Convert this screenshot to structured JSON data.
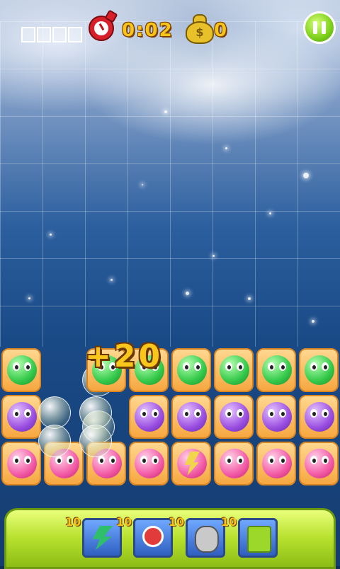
{
  "hud": {
    "timer": "0:02",
    "coins": "0",
    "progress_slots": 4,
    "clock_icon": "alarm-clock-icon",
    "bag_icon": "money-bag-icon",
    "bag_symbol": "$",
    "pause_icon": "pause-icon"
  },
  "board": {
    "score_popup": "+20",
    "rows": [
      [
        "green",
        "bubble",
        "green",
        "green",
        "green",
        "green",
        "green",
        "green"
      ],
      [
        "purple",
        "bubble",
        "empty",
        "purple",
        "purple",
        "purple",
        "purple",
        "purple"
      ],
      [
        "pink",
        "pink",
        "pink",
        "pink",
        "bolt",
        "pink",
        "pink",
        "pink"
      ]
    ]
  },
  "powerups": [
    {
      "name": "lightning",
      "icon": "lightning-icon",
      "count": "10",
      "color": "#2fbf6a"
    },
    {
      "name": "clock",
      "icon": "alarm-clock-icon",
      "count": "10",
      "color": "#e23b3b"
    },
    {
      "name": "bomb",
      "icon": "bomb-icon",
      "count": "10",
      "color": "#c9c9c9"
    },
    {
      "name": "block",
      "icon": "square-block-icon",
      "count": "10",
      "color": "#9bd82a"
    }
  ],
  "colors": {
    "accent": "#f7c41a",
    "pause_green": "#7ccf1a",
    "tray_green": "#b6e02c"
  }
}
